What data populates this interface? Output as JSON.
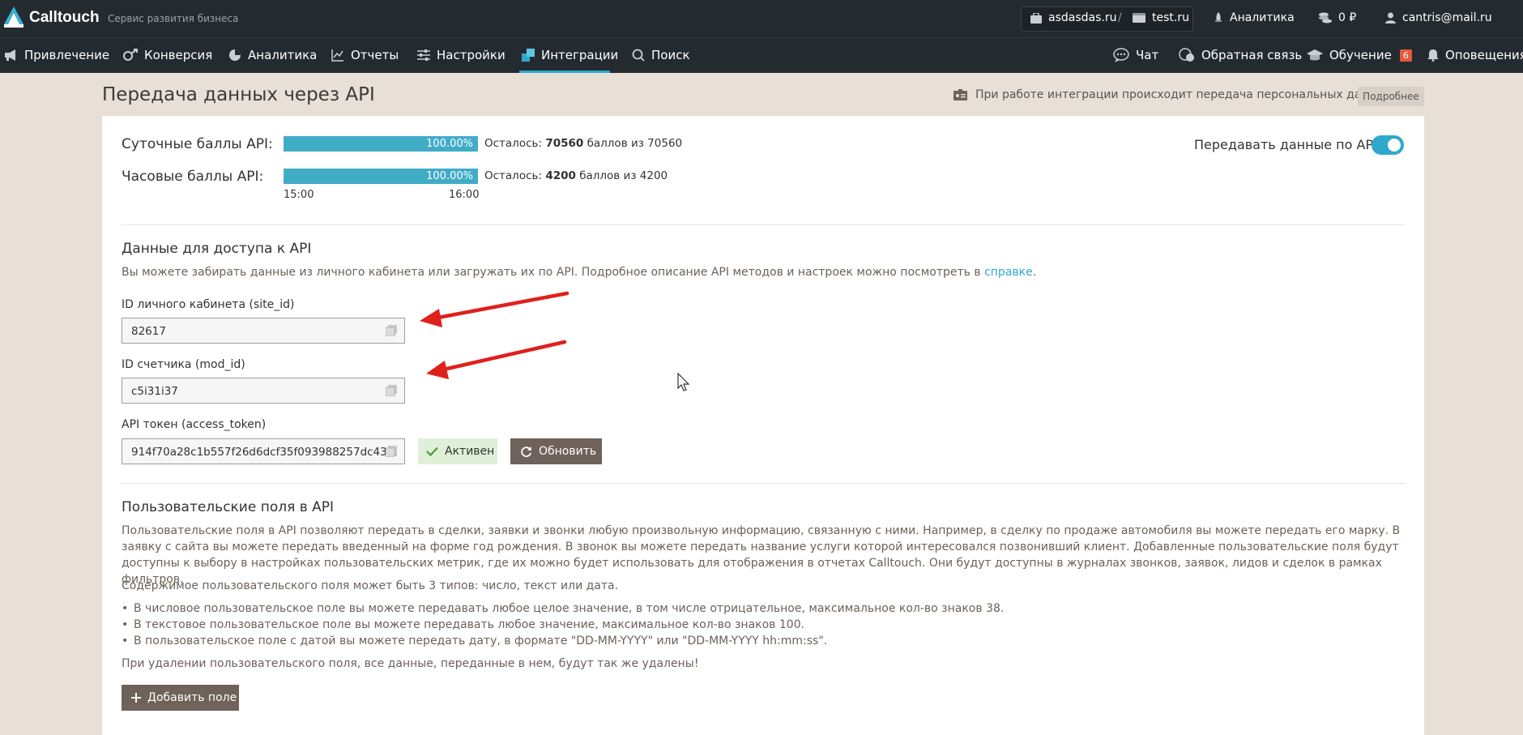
{
  "header": {
    "brand": "Calltouch",
    "tagline": "Сервис развития бизнеса",
    "project": "asdasdas.ru",
    "separator": "/",
    "site": "test.ru",
    "analytics": "Аналитика",
    "balance": "0 ₽",
    "user": "cantris@mail.ru"
  },
  "nav": {
    "items": [
      {
        "label": "Привлечение",
        "icon": "megaphone-icon"
      },
      {
        "label": "Конверсия",
        "icon": "conversion-icon"
      },
      {
        "label": "Аналитика",
        "icon": "pie-chart-icon"
      },
      {
        "label": "Отчеты",
        "icon": "line-chart-icon"
      },
      {
        "label": "Настройки",
        "icon": "sliders-icon"
      },
      {
        "label": "Интеграции",
        "icon": "puzzle-icon"
      },
      {
        "label": "Поиск",
        "icon": "search-icon"
      }
    ],
    "right": [
      {
        "label": "Чат",
        "icon": "chat-icon"
      },
      {
        "label": "Обратная связь",
        "icon": "feedback-icon"
      },
      {
        "label": "Обучение",
        "icon": "graduation-cap-icon",
        "badge": "6"
      },
      {
        "label": "Оповещения",
        "icon": "bell-icon"
      }
    ],
    "active": "Интеграции"
  },
  "page": {
    "title": "Передача данных через API",
    "notice": "При работе интеграции происходит передача персональных данных",
    "more_label": "Подробнее"
  },
  "quota": {
    "daily_label": "Суточные баллы API:",
    "daily_percent": "100.00%",
    "daily_fill": 1.0,
    "daily_prefix": "Осталось:",
    "daily_left": "70560",
    "daily_suffix": "баллов из 70560",
    "hourly_label": "Часовые баллы API:",
    "hourly_percent": "100.00%",
    "hourly_fill": 1.0,
    "hourly_prefix": "Осталось:",
    "hourly_left": "4200",
    "hourly_suffix": "баллов из 4200",
    "tick_start": "15:00",
    "tick_end": "16:00",
    "toggle_label": "Передавать данные по API",
    "toggle_on": true
  },
  "access": {
    "title": "Данные для доступа к API",
    "desc": "Вы можете забирать данные из личного кабинета или загружать их по API. Подробное описание API методов и настроек можно посмотреть в",
    "desc_link": "справке",
    "desc_end": ".",
    "site_id_label": "ID личного кабинета (site_id)",
    "site_id_value": "82617",
    "mod_id_label": "ID счетчика (mod_id)",
    "mod_id_value": "c5i31i37",
    "token_label": "API токен (access_token)",
    "token_value": "914f70a28c1b557f26d6dcf35f093988257dc43...",
    "status_label": "Активен",
    "refresh_label": "Обновить"
  },
  "custom": {
    "title": "Пользовательские поля в API",
    "para1": "Пользовательские поля в API позволяют передать в сделки, заявки и звонки любую произвольную информацию, связанную с ними. Например, в сделку по продаже автомобиля вы можете передать его марку. В заявку с сайта вы можете передать введенный на форме год рождения. В звонок вы можете передать название услуги которой интересовался позвонивший клиент. Добавленные пользовательские поля будут доступны к выбору в настройках пользовательских метрик, где их можно будет использовать для отображения в отчетах Calltouch. Они будут доступны в журналах звонков, заявок, лидов и сделок в рамках фильтров.",
    "para2": "Содержимое пользовательского поля может быть 3 типов: число, текст или дата.",
    "bullets": [
      "В числовое пользовательское поле вы можете передавать любое целое значение, в том числе отрицательное, максимальное кол-во знаков 38.",
      "В текстовое пользовательское поле вы можете передавать любое значение, максимальное кол-во знаков 100.",
      "В пользовательское поле с датой вы можете передать дату, в формате \"DD-MM-YYYY\" или \"DD-MM-YYYY hh:mm:ss\"."
    ],
    "warning": "При удалении пользовательского поля, все данные, переданные в нем, будут так же удалены!",
    "add_label": "Добавить поле"
  },
  "colors": {
    "header_bg": "#242b30",
    "accent": "#2fa8cc",
    "page_bg": "#e8dfd6",
    "button_dark": "#6e625a",
    "arrow": "#e0201b"
  }
}
